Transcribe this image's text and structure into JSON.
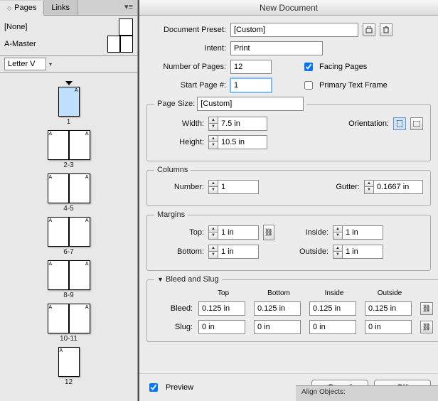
{
  "panel": {
    "tabs": {
      "pages": "Pages",
      "links": "Links"
    },
    "masters": {
      "none": "[None]",
      "amaster": "A-Master"
    },
    "size_dropdown": "Letter V",
    "spreads": [
      {
        "label": "1",
        "pages": 1,
        "first": true,
        "selected": true
      },
      {
        "label": "2-3",
        "pages": 2
      },
      {
        "label": "4-5",
        "pages": 2
      },
      {
        "label": "6-7",
        "pages": 2
      },
      {
        "label": "8-9",
        "pages": 2
      },
      {
        "label": "10-11",
        "pages": 2
      },
      {
        "label": "12",
        "pages": 1,
        "last": true
      }
    ]
  },
  "dialog": {
    "title": "New Document",
    "preset_label": "Document Preset:",
    "preset_value": "[Custom]",
    "intent_label": "Intent:",
    "intent_value": "Print",
    "numpages_label": "Number of Pages:",
    "numpages_value": "12",
    "facing_label": "Facing Pages",
    "facing_checked": true,
    "startpage_label": "Start Page #:",
    "startpage_value": "1",
    "primary_label": "Primary Text Frame",
    "primary_checked": false,
    "pagesize": {
      "legend": "Page Size:",
      "preset": "[Custom]",
      "width_label": "Width:",
      "width_value": "7.5 in",
      "height_label": "Height:",
      "height_value": "10.5 in",
      "orientation_label": "Orientation:"
    },
    "columns": {
      "legend": "Columns",
      "number_label": "Number:",
      "number_value": "1",
      "gutter_label": "Gutter:",
      "gutter_value": "0.1667 in"
    },
    "margins": {
      "legend": "Margins",
      "top_label": "Top:",
      "top_value": "1 in",
      "bottom_label": "Bottom:",
      "bottom_value": "1 in",
      "inside_label": "Inside:",
      "inside_value": "1 in",
      "outside_label": "Outside:",
      "outside_value": "1 in"
    },
    "bleedslug": {
      "legend": "Bleed and Slug",
      "headers": {
        "top": "Top",
        "bottom": "Bottom",
        "inside": "Inside",
        "outside": "Outside"
      },
      "bleed_label": "Bleed:",
      "bleed": {
        "top": "0.125 in",
        "bottom": "0.125 in",
        "inside": "0.125 in",
        "outside": "0.125 in"
      },
      "slug_label": "Slug:",
      "slug": {
        "top": "0 in",
        "bottom": "0 in",
        "inside": "0 in",
        "outside": "0 in"
      }
    },
    "preview_label": "Preview",
    "preview_checked": true,
    "cancel": "Cancel",
    "ok": "OK",
    "align_strip": "Align Objects:"
  }
}
